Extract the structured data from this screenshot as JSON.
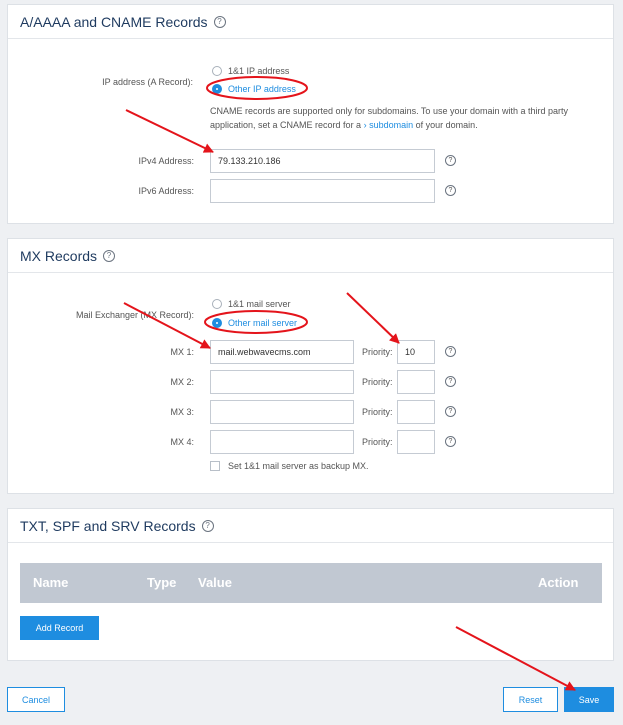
{
  "dns": {
    "title": "A/AAAA and CNAME Records",
    "ip_label": "IP address (A Record):",
    "ip_options": [
      "1&1 IP address",
      "Other IP address"
    ],
    "info_line1": "CNAME records are supported only for subdomains. To use your domain with a third party",
    "info_prefix": "application, set a CNAME record for a",
    "info_link": "subdomain",
    "info_suffix": "of your domain.",
    "ipv4_label": "IPv4 Address:",
    "ipv4_value": "79.133.210.186",
    "ipv6_label": "IPv6 Address:",
    "ipv6_value": ""
  },
  "mx": {
    "title": "MX Records",
    "exchanger_label": "Mail Exchanger (MX Record):",
    "options": [
      "1&1 mail server",
      "Other mail server"
    ],
    "rows": [
      {
        "label": "MX 1:",
        "value": "mail.webwavecms.com",
        "priority_label": "Priority:",
        "priority": "10"
      },
      {
        "label": "MX 2:",
        "value": "",
        "priority_label": "Priority:",
        "priority": ""
      },
      {
        "label": "MX 3:",
        "value": "",
        "priority_label": "Priority:",
        "priority": ""
      },
      {
        "label": "MX 4:",
        "value": "",
        "priority_label": "Priority:",
        "priority": ""
      }
    ],
    "backup_label": "Set 1&1 mail server as backup MX."
  },
  "txt": {
    "title": "TXT, SPF and SRV Records",
    "columns": [
      "Name",
      "Type",
      "Value",
      "Action"
    ],
    "add_button": "Add Record"
  },
  "footer": {
    "cancel": "Cancel",
    "reset": "Reset",
    "save": "Save"
  },
  "icons": {
    "help": "?",
    "chevron": "›"
  },
  "colors": {
    "accent": "#1e8de0",
    "annotation": "#e4141b",
    "table_header": "#c1c8d2"
  }
}
